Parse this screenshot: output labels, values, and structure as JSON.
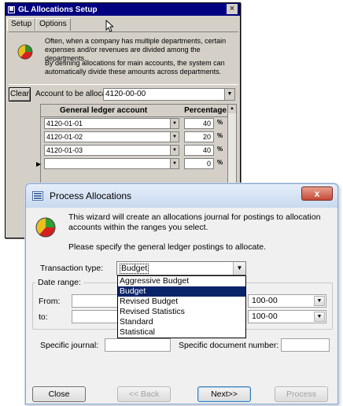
{
  "gl_window": {
    "title": "GL Allocations Setup",
    "close_glyph": "×",
    "tabs": [
      {
        "label": "Setup"
      },
      {
        "label": "Options"
      }
    ],
    "description": {
      "p1": "Often, when a company has multiple departments, certain expenses and/or revenues are divided among the departments.",
      "p2": "By defining allocations for main accounts, the system can automatically divide these amounts across departments."
    },
    "clear_label": "Clear",
    "account_label": "Account to be allocated:",
    "account_value": "4120-00-00",
    "grid": {
      "headers": {
        "account": "General ledger account",
        "percentage": "Percentage"
      },
      "rows": [
        {
          "account": "4120-01-01",
          "percentage": "40",
          "unit": "%"
        },
        {
          "account": "4120-01-02",
          "percentage": "20",
          "unit": "%"
        },
        {
          "account": "4120-01-03",
          "percentage": "40",
          "unit": "%"
        },
        {
          "account": "",
          "percentage": "0",
          "unit": "%"
        }
      ]
    }
  },
  "pa_window": {
    "title": "Process Allocations",
    "close_glyph": "x",
    "intro": "This wizard will create an allocations journal for postings to allocation accounts within the ranges you select.",
    "specify": "Please specify the general ledger postings to allocate.",
    "transaction_type": {
      "label": "Transaction type:",
      "value": "Budget",
      "options": [
        "Aggressive Budget",
        "Budget",
        "Revised Budget",
        "Revised Statistics",
        "Standard",
        "Statistical"
      ],
      "selected_index": 1
    },
    "date_range": {
      "legend": "Date range:",
      "from_label": "From:",
      "to_label": "to:",
      "from_account": "100-00",
      "to_account": "100-00"
    },
    "specific_journal_label": "Specific journal:",
    "specific_document_label": "Specific document number:",
    "buttons": {
      "close": "Close",
      "back": "<< Back",
      "next": "Next>>",
      "process": "Process"
    }
  }
}
